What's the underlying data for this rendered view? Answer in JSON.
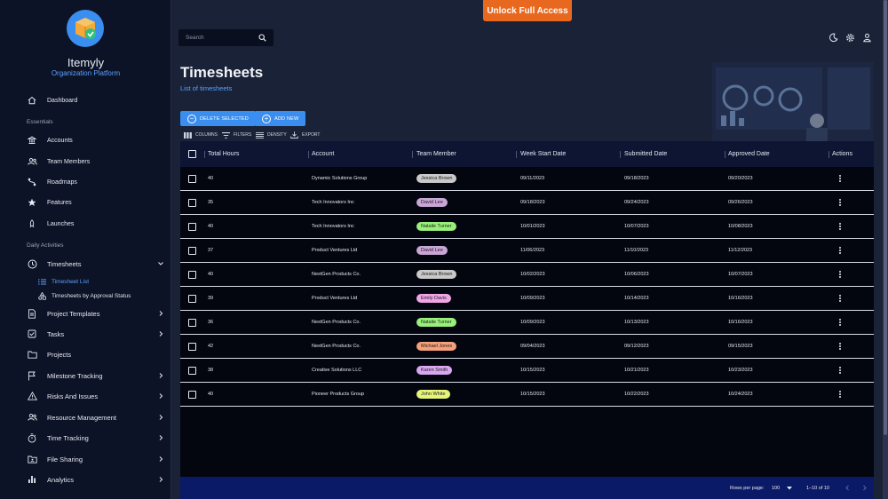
{
  "banner": {
    "unlock_label": "Unlock Full Access"
  },
  "brand": {
    "name": "Itemyly",
    "subtitle": "Organization Platform"
  },
  "search": {
    "placeholder": "Search"
  },
  "sidebar": {
    "dashboard": "Dashboard",
    "essentials_label": "Essentials",
    "essentials": [
      "Accounts",
      "Team Members",
      "Roadmaps",
      "Features",
      "Launches"
    ],
    "daily_label": "Daily Activities",
    "timesheets": "Timesheets",
    "timesheets_children": [
      "Timesheet List",
      "Timesheets by Approval Status"
    ],
    "daily": [
      "Project Templates",
      "Tasks",
      "Projects",
      "Milestone Tracking",
      "Risks And Issues",
      "Resource Management",
      "Time Tracking",
      "File Sharing",
      "Analytics"
    ]
  },
  "page": {
    "title": "Timesheets",
    "subtitle": "List of timesheets"
  },
  "actions": {
    "delete_label": "DELETE SELECTED",
    "add_label": "ADD NEW"
  },
  "toolbar": {
    "columns": "COLUMNS",
    "filters": "FILTERS",
    "density": "DENSITY",
    "export": "EXPORT"
  },
  "table": {
    "headers": [
      "Total Hours",
      "Account",
      "Team Member",
      "Week Start Date",
      "Submitted Date",
      "Approved Date",
      "Actions"
    ],
    "rows": [
      {
        "hours": "40",
        "account": "Dynamic Solutions Group",
        "member": "Jessica Brown",
        "chip": "#c9c9c9",
        "week": "09/11/2023",
        "submitted": "09/18/2023",
        "approved": "09/20/2023"
      },
      {
        "hours": "35",
        "account": "Tech Innovators Inc",
        "member": "David Lee",
        "chip": "#c9a6d6",
        "week": "09/18/2023",
        "submitted": "09/24/2023",
        "approved": "09/26/2023"
      },
      {
        "hours": "40",
        "account": "Tech Innovators Inc",
        "member": "Natalie Turner",
        "chip": "#98f07a",
        "week": "10/01/2023",
        "submitted": "10/07/2023",
        "approved": "10/08/2023"
      },
      {
        "hours": "37",
        "account": "Product Ventures Ltd",
        "member": "David Lee",
        "chip": "#c9a6d6",
        "week": "11/06/2023",
        "submitted": "11/10/2023",
        "approved": "11/12/2023"
      },
      {
        "hours": "40",
        "account": "NextGen Products Co.",
        "member": "Jessica Brown",
        "chip": "#c9c9c9",
        "week": "10/02/2023",
        "submitted": "10/06/2023",
        "approved": "10/07/2023"
      },
      {
        "hours": "39",
        "account": "Product Ventures Ltd",
        "member": "Emily Davis",
        "chip": "#f0a6e6",
        "week": "10/09/2023",
        "submitted": "10/14/2023",
        "approved": "10/16/2023"
      },
      {
        "hours": "36",
        "account": "NextGen Products Co.",
        "member": "Natalie Turner",
        "chip": "#98f07a",
        "week": "10/09/2023",
        "submitted": "10/13/2023",
        "approved": "10/16/2023"
      },
      {
        "hours": "42",
        "account": "NextGen Products Co.",
        "member": "Michael Jones",
        "chip": "#f5a07a",
        "week": "09/04/2023",
        "submitted": "09/12/2023",
        "approved": "09/15/2023"
      },
      {
        "hours": "38",
        "account": "Creative Solutions LLC",
        "member": "Karen Smith",
        "chip": "#d9a6f0",
        "week": "10/15/2023",
        "submitted": "10/21/2023",
        "approved": "10/23/2023"
      },
      {
        "hours": "40",
        "account": "Pioneer Products Group",
        "member": "John White",
        "chip": "#e6f57a",
        "week": "10/15/2023",
        "submitted": "10/22/2023",
        "approved": "10/24/2023"
      }
    ]
  },
  "footer": {
    "rows_per_page_label": "Rows per page:",
    "rows_per_page": "100",
    "range": "1–10 of 10"
  },
  "colors": {
    "accent": "#3a8ef0",
    "unlock": "#e8681f",
    "sidebar": "#0d1326",
    "footer": "#0b1a66"
  }
}
